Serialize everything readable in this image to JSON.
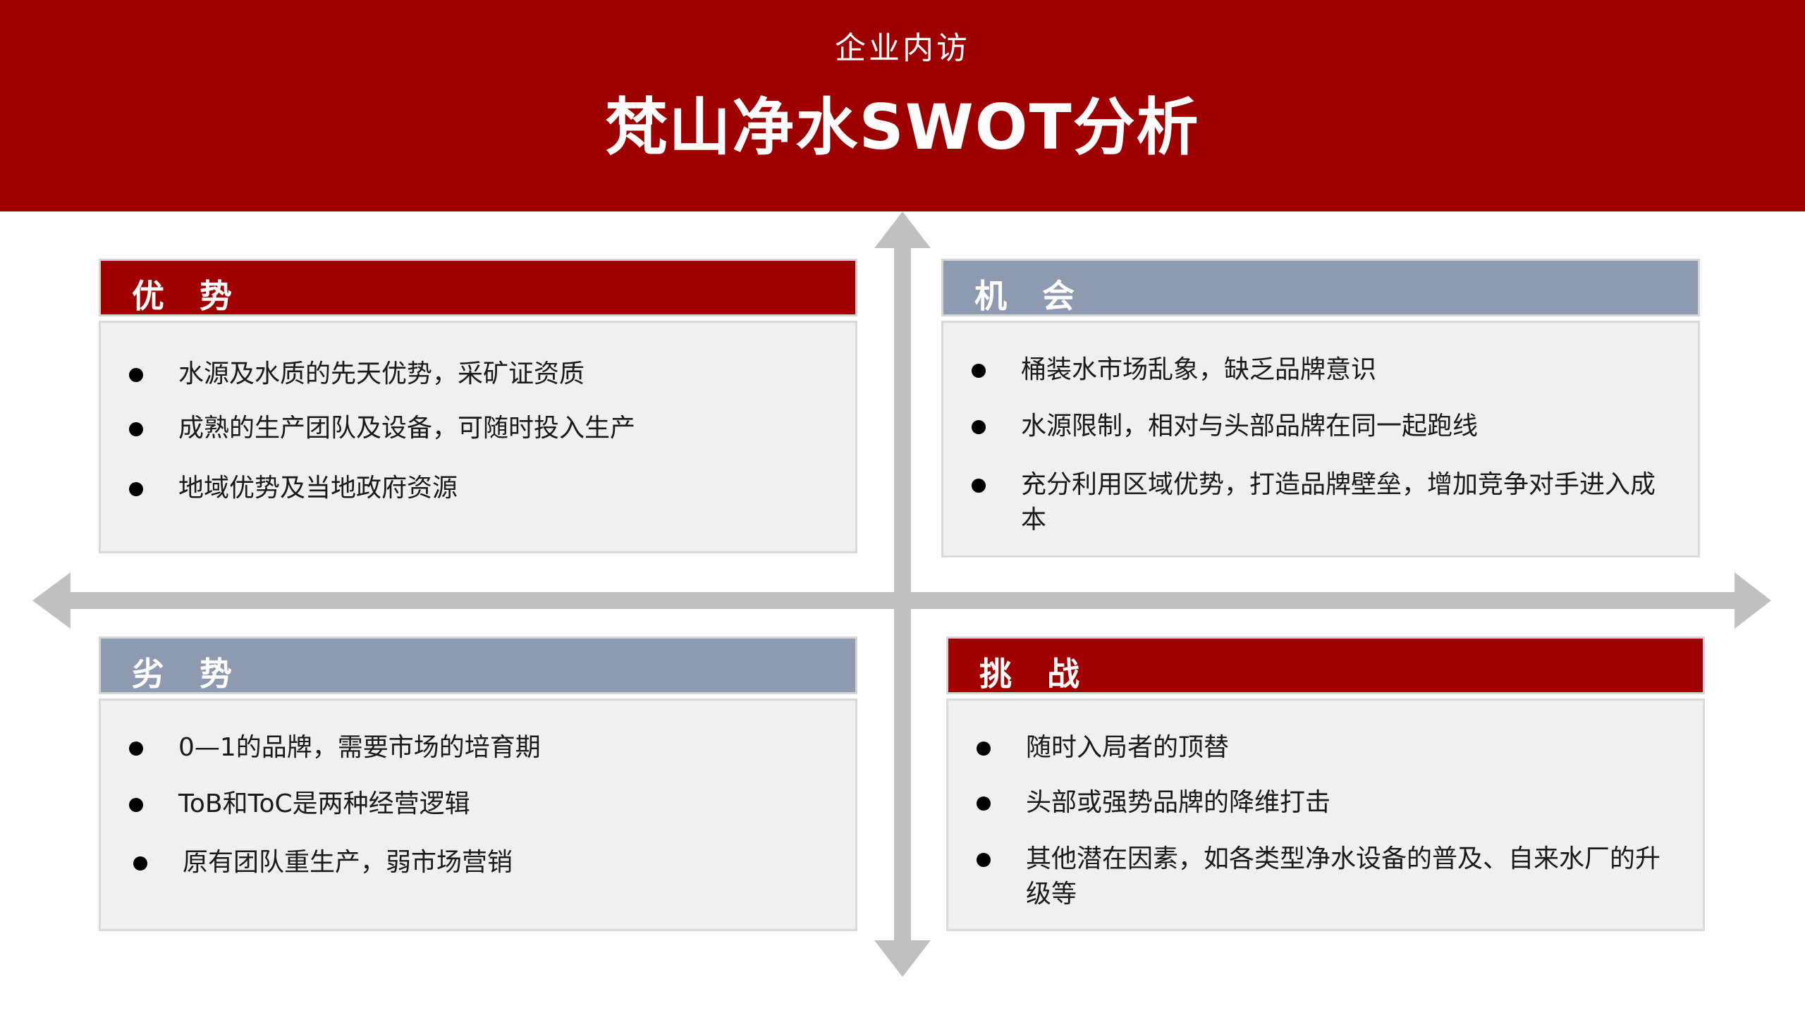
{
  "header": {
    "subtitle": "企业内访",
    "title": "梵山净水SWOT分析"
  },
  "colors": {
    "brand_red": "#9e0000",
    "head_gray": "#8e9aaf",
    "body_bg": "#f0f0f0",
    "axis_gray": "#c0c0c0"
  },
  "quadrants": {
    "strengths": {
      "title": "优势",
      "items": [
        "水源及水质的先天优势，采矿证资质",
        "成熟的生产团队及设备，可随时投入生产",
        "地域优势及当地政府资源"
      ]
    },
    "opportunities": {
      "title": "机会",
      "items": [
        "桶装水市场乱象，缺乏品牌意识",
        "水源限制，相对与头部品牌在同一起跑线",
        "充分利用区域优势，打造品牌壁垒，增加竞争对手进入成本"
      ]
    },
    "weaknesses": {
      "title": "劣势",
      "items": [
        "0—1的品牌，需要市场的培育期",
        "ToB和ToC是两种经营逻辑",
        "原有团队重生产，弱市场营销"
      ]
    },
    "threats": {
      "title": "挑战",
      "items": [
        "随时入局者的顶替",
        "头部或强势品牌的降维打击",
        "其他潜在因素，如各类型净水设备的普及、自来水厂的升级等"
      ]
    }
  }
}
